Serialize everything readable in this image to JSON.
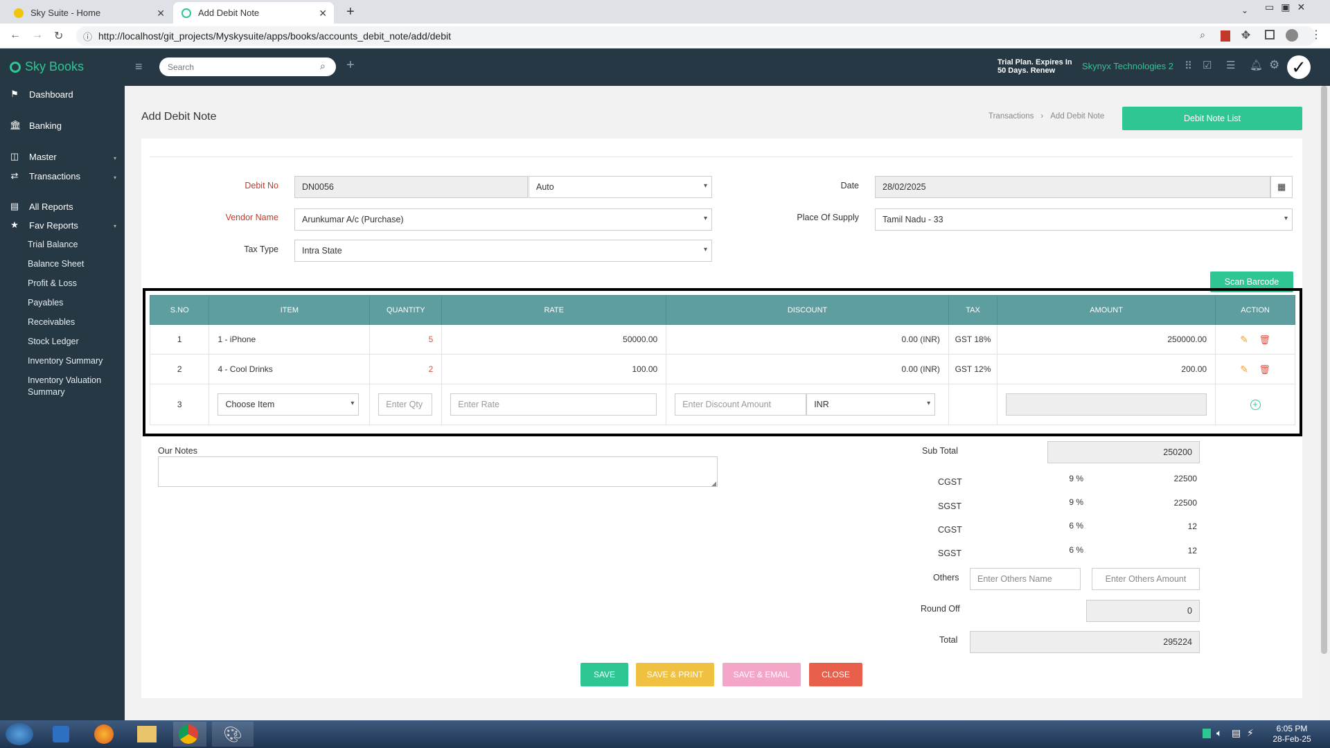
{
  "browser": {
    "tabs": [
      {
        "title": "Sky Suite - Home"
      },
      {
        "title": "Add Debit Note"
      }
    ],
    "url": "http://localhost/git_projects/Myskysuite/apps/books/accounts_debit_note/add/debit"
  },
  "header": {
    "brand": "Sky Books",
    "search_placeholder": "Search",
    "trial_line1": "Trial Plan. Expires In",
    "trial_line2": "50 Days. Renew",
    "company": "Skynyx Technologies 2"
  },
  "sidebar": {
    "main": [
      {
        "label": "Dashboard"
      },
      {
        "label": "Banking"
      },
      {
        "label": "Master"
      },
      {
        "label": "Transactions"
      },
      {
        "label": "All Reports"
      },
      {
        "label": "Fav Reports"
      }
    ],
    "sub": [
      "Trial Balance",
      "Balance Sheet",
      "Profit & Loss",
      "Payables",
      "Receivables",
      "Stock Ledger",
      "Inventory Summary",
      "Inventory Valuation",
      "Summary"
    ]
  },
  "page": {
    "title": "Add Debit Note",
    "breadcrumb_1": "Transactions",
    "breadcrumb_sep": "›",
    "breadcrumb_2": "Add Debit Note",
    "list_button": "Debit Note List"
  },
  "form": {
    "debit_no_label": "Debit No",
    "debit_no": "DN0056",
    "numbering": "Auto",
    "date_label": "Date",
    "date": "28/02/2025",
    "vendor_label": "Vendor Name",
    "vendor": "Arunkumar A/c (Purchase)",
    "pos_label": "Place Of Supply",
    "pos": "Tamil Nadu - 33",
    "tax_type_label": "Tax Type",
    "tax_type": "Intra State",
    "scan_barcode": "Scan Barcode"
  },
  "table": {
    "headers": [
      "S.NO",
      "ITEM",
      "QUANTITY",
      "RATE",
      "DISCOUNT",
      "TAX",
      "AMOUNT",
      "ACTION"
    ],
    "rows": [
      {
        "sno": "1",
        "item": "1 - iPhone",
        "qty": "5",
        "rate": "50000.00",
        "discount": "0.00 (INR)",
        "tax": "GST 18%",
        "amount": "250000.00"
      },
      {
        "sno": "2",
        "item": "4 - Cool Drinks",
        "qty": "2",
        "rate": "100.00",
        "discount": "0.00 (INR)",
        "tax": "GST 12%",
        "amount": "200.00"
      }
    ],
    "entry": {
      "sno": "3",
      "item_placeholder": "Choose Item",
      "qty_placeholder": "Enter Qty",
      "rate_placeholder": "Enter Rate",
      "discount_placeholder": "Enter Discount Amount",
      "currency": "INR"
    }
  },
  "notes": {
    "label": "Our Notes"
  },
  "totals": {
    "sub_total_label": "Sub Total",
    "sub_total": "250200",
    "taxes": [
      {
        "name": "CGST",
        "pct": "9 %",
        "value": "22500"
      },
      {
        "name": "SGST",
        "pct": "9 %",
        "value": "22500"
      },
      {
        "name": "CGST",
        "pct": "6 %",
        "value": "12"
      },
      {
        "name": "SGST",
        "pct": "6 %",
        "value": "12"
      }
    ],
    "others_label": "Others",
    "others_name_placeholder": "Enter Others Name",
    "others_amount_placeholder": "Enter Others Amount",
    "round_off_label": "Round Off",
    "round_off": "0",
    "total_label": "Total",
    "total": "295224"
  },
  "actions": {
    "save": "SAVE",
    "save_print": "SAVE & PRINT",
    "save_email": "SAVE & EMAIL",
    "close": "CLOSE"
  },
  "taskbar": {
    "time": "6:05 PM",
    "date": "28-Feb-25"
  },
  "colors": {
    "accent": "#2ec793",
    "header": "#263844",
    "table_header": "#5f9ea0",
    "save": "#2ec793",
    "save_print": "#f0c040",
    "save_email": "#f4a6c8",
    "close": "#e8604c"
  }
}
